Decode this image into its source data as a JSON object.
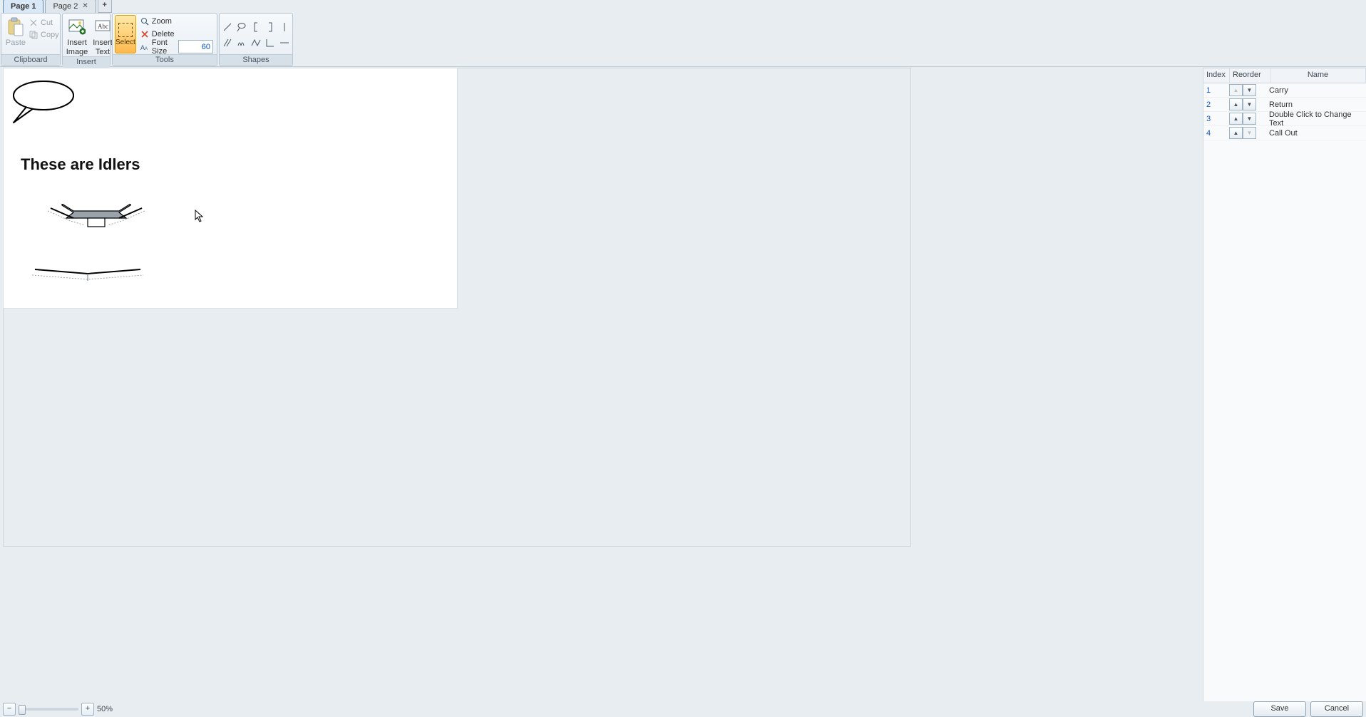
{
  "tabs": {
    "page1": "Page 1",
    "page2": "Page 2"
  },
  "ribbon": {
    "clipboard": {
      "group": "Clipboard",
      "paste": "Paste",
      "cut": "Cut",
      "copy": "Copy"
    },
    "insert": {
      "group": "Insert",
      "image_line1": "Insert",
      "image_line2": "Image",
      "text_line1": "Insert",
      "text_line2": "Text"
    },
    "tools": {
      "group": "Tools",
      "select": "Select",
      "zoom": "Zoom",
      "delete": "Delete",
      "font_size_label": "Font Size",
      "font_size_value": "60"
    },
    "shapes": {
      "group": "Shapes"
    }
  },
  "canvas": {
    "heading": "These are Idlers"
  },
  "panel": {
    "head_index": "Index",
    "head_reorder": "Reorder",
    "head_name": "Name",
    "items": [
      {
        "index": "1",
        "name": "Carry"
      },
      {
        "index": "2",
        "name": "Return"
      },
      {
        "index": "3",
        "name": "Double Click to Change Text"
      },
      {
        "index": "4",
        "name": "Call Out"
      }
    ]
  },
  "zoom": {
    "label": "50%"
  },
  "actions": {
    "save": "Save",
    "cancel": "Cancel"
  }
}
